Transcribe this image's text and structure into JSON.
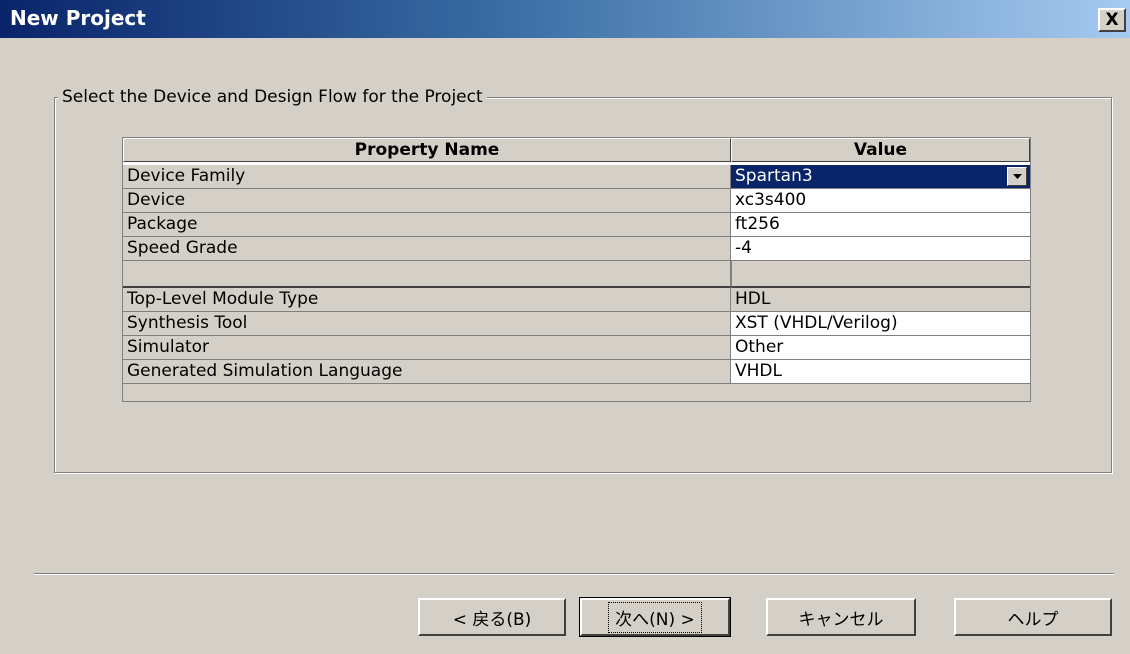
{
  "window": {
    "title": "New Project",
    "close_label": "X"
  },
  "group": {
    "label": "Select the Device and Design Flow for the Project"
  },
  "grid": {
    "headers": [
      "Property Name",
      "Value"
    ],
    "rows": [
      {
        "name": "Device Family",
        "value": "Spartan3"
      },
      {
        "name": "Device",
        "value": "xc3s400"
      },
      {
        "name": "Package",
        "value": "ft256"
      },
      {
        "name": "Speed Grade",
        "value": "-4"
      },
      {
        "name": "Top-Level Module Type",
        "value": "HDL"
      },
      {
        "name": "Synthesis Tool",
        "value": "XST (VHDL/Verilog)"
      },
      {
        "name": "Simulator",
        "value": "Other"
      },
      {
        "name": "Generated Simulation Language",
        "value": "VHDL"
      }
    ]
  },
  "buttons": {
    "back": "< 戻る(B)",
    "next": "次へ(N) >",
    "cancel": "キャンセル",
    "help": "ヘルプ"
  }
}
